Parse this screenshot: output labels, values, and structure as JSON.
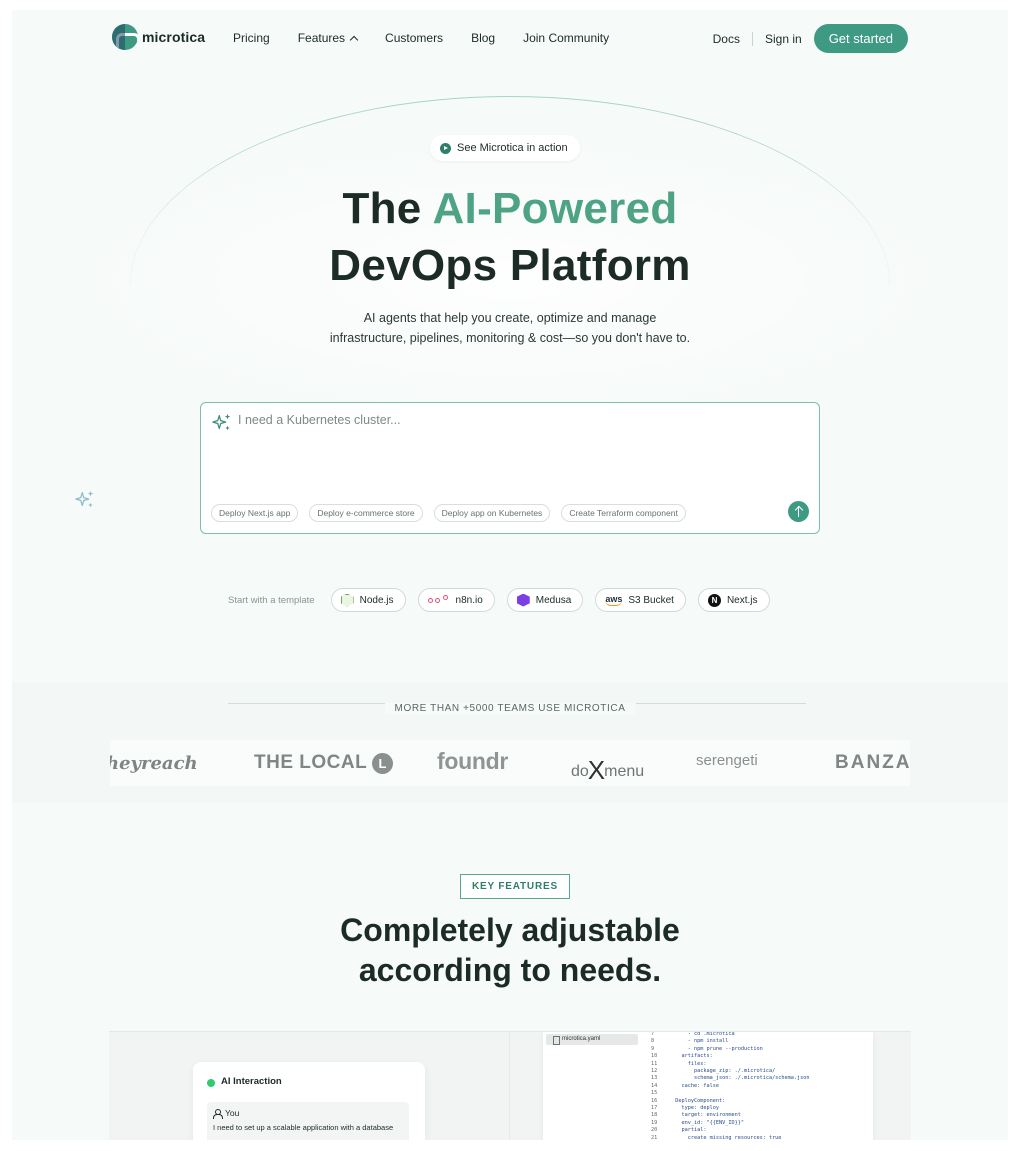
{
  "nav": {
    "logo_text": "microtica",
    "links": [
      "Pricing",
      "Features",
      "Customers",
      "Blog",
      "Join Community"
    ],
    "docs": "Docs",
    "signin": "Sign in",
    "cta": "Get started"
  },
  "hero": {
    "action_pill": "See Microtica in action",
    "title_part1": "The ",
    "title_accent": "AI-Powered",
    "title_line2": "DevOps Platform",
    "subtitle_line1": "AI agents that help you create, optimize and manage",
    "subtitle_line2": "infrastructure, pipelines, monitoring & cost—so you don't have to."
  },
  "prompt": {
    "placeholder": "I need a Kubernetes cluster...",
    "chips": [
      "Deploy Next.js app",
      "Deploy e-commerce store",
      "Deploy app on Kubernetes",
      "Create Terraform component"
    ]
  },
  "templates": {
    "label": "Start with a template",
    "items": [
      {
        "name": "Node.js",
        "icon": "nodejs-icon"
      },
      {
        "name": "n8n.io",
        "icon": "n8n-icon"
      },
      {
        "name": "Medusa",
        "icon": "medusa-icon"
      },
      {
        "name": "S3 Bucket",
        "icon": "aws-icon",
        "icon_text": "aws"
      },
      {
        "name": "Next.js",
        "icon": "nextjs-icon",
        "icon_text": "N"
      }
    ]
  },
  "teams": {
    "heading": "MORE THAN +5000 TEAMS USE MICROTICA",
    "logos": {
      "heyreach": "heyreach",
      "thelocal": "THE LOCAL",
      "thelocal_badge": "L",
      "foundr": "foundr",
      "doxmenu_pre": "do",
      "doxmenu_x": "X",
      "doxmenu_post": "menu",
      "serengeti": "serengeti",
      "banzai": "BANZAI"
    }
  },
  "features": {
    "tag": "KEY FEATURES",
    "title_line1": "Completely adjustable",
    "title_line2": "according to needs."
  },
  "preview": {
    "ai_title": "AI Interaction",
    "user_label": "You",
    "user_message": "I need to set up a scalable application with a database",
    "file_name": "microtica.yaml",
    "code_lines": [
      {
        "n": "7",
        "t": "      - cd .microtica"
      },
      {
        "n": "8",
        "t": "      - npm install"
      },
      {
        "n": "9",
        "t": "      - npm prune --production"
      },
      {
        "n": "10",
        "t": "    artifacts:"
      },
      {
        "n": "11",
        "t": "      files:"
      },
      {
        "n": "12",
        "t": "        package_zip: ./.microtica/"
      },
      {
        "n": "13",
        "t": "        schema_json: ./.microtica/schema.json"
      },
      {
        "n": "14",
        "t": "    cache: false"
      },
      {
        "n": "15",
        "t": ""
      },
      {
        "n": "16",
        "t": "  DeployComponent:"
      },
      {
        "n": "17",
        "t": "    type: deploy"
      },
      {
        "n": "18",
        "t": "    target: environment"
      },
      {
        "n": "19",
        "t": "    env_id: \"{{ENV_ID}}\""
      },
      {
        "n": "20",
        "t": "    partial:"
      },
      {
        "n": "21",
        "t": "      create_missing_resources: true"
      }
    ]
  },
  "colors": {
    "accent": "#3f9a83",
    "accent_text": "#4fa385",
    "heading": "#1d2b27",
    "background": "#f6faf8"
  }
}
